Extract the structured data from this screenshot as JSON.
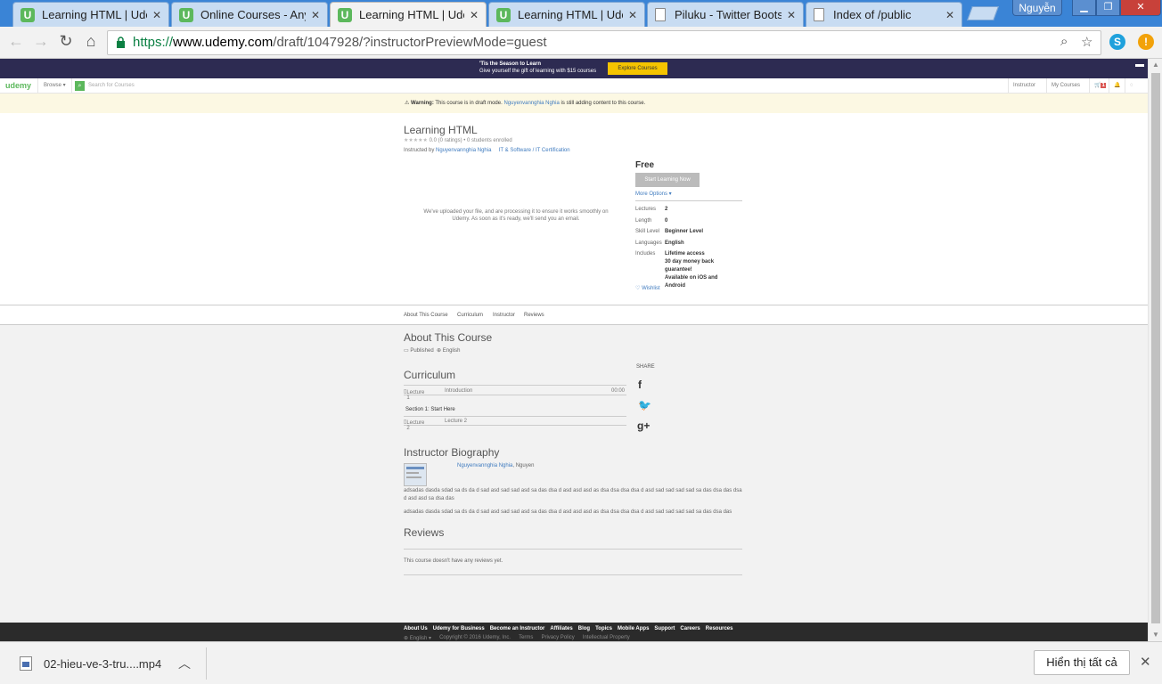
{
  "browser": {
    "tabs": [
      {
        "title": "Learning HTML | Udem",
        "icon": "udemy-icon",
        "active": false
      },
      {
        "title": "Online Courses - Anyt",
        "icon": "udemy-icon",
        "active": false
      },
      {
        "title": "Learning HTML | Udem",
        "icon": "udemy-icon",
        "active": true
      },
      {
        "title": "Learning HTML | Udem",
        "icon": "udemy-icon",
        "active": false
      },
      {
        "title": "Piluku - Twitter Boots",
        "icon": "document-icon",
        "active": false
      },
      {
        "title": "Index of /public",
        "icon": "document-icon",
        "active": false
      }
    ],
    "user": "Nguyễn",
    "url": {
      "scheme": "https://",
      "host": "www.udemy.com",
      "path": "/draft/1047928/?instructorPreviewMode=guest"
    }
  },
  "promo": {
    "line1": "'Tis the Season to Learn",
    "line2": "Give yourself the gift of learning with $15 courses",
    "cta": "Explore Courses"
  },
  "header": {
    "logo": "udemy",
    "browse": "Browse",
    "search_placeholder": "Search for Courses",
    "instructor": "Instructor",
    "my_courses": "My Courses",
    "cart_count": "1"
  },
  "warning": {
    "label": "Warning:",
    "text_before": "This course is in draft mode.",
    "author": "Nguyenvannghia Nghia",
    "text_after": "is still adding content to this course."
  },
  "course": {
    "title": "Learning HTML",
    "rating": "0.0 (0 ratings)",
    "students": "0 students enrolled",
    "instructed_by": "Instructed by",
    "instructor": "Nguyenvannghia Nghia",
    "category": "IT & Software / IT Certification",
    "video_message": "We've uploaded your file, and are processing it to ensure it works smoothly on Udemy. As soon as it's ready, we'll send you an email.",
    "price": "Free",
    "start_button": "Start Learning Now",
    "more_options": "More Options",
    "specs": [
      {
        "key": "Lectures",
        "value": "2"
      },
      {
        "key": "Length",
        "value": "0"
      },
      {
        "key": "Skill Level",
        "value": "Beginner Level"
      },
      {
        "key": "Languages",
        "value": "English"
      },
      {
        "key": "Includes",
        "value": "Lifetime access"
      }
    ],
    "includes_extra": [
      "30 day money back guarantee!",
      "Available on iOS and Android"
    ],
    "wishlist": "Wishlist"
  },
  "subnav": [
    "About This Course",
    "Curriculum",
    "Instructor",
    "Reviews"
  ],
  "about": {
    "title": "About This Course",
    "published": "Published",
    "language": "English"
  },
  "curriculum": {
    "title": "Curriculum",
    "lecture1": {
      "label": "Lecture 1",
      "name": "Introduction",
      "time": "00:00"
    },
    "section": "Section 1: Start Here",
    "lecture2": {
      "label": "Lecture 2",
      "name": "Lecture 2"
    }
  },
  "share": {
    "label": "SHARE",
    "icons": [
      "facebook-icon",
      "twitter-icon",
      "google-plus-icon"
    ]
  },
  "bio": {
    "title": "Instructor Biography",
    "name_link": "Nguyenvannghia Nghia",
    "name_suffix": ", Nguyen",
    "p1": "adsadas dasda  sdad sa ds da d sad asd sad sad asd sa das dsa d asd asd asd as dsa dsa dsa dsa d asd sad sad sad sad sa das dsa das dsa d asd asd sa dsa das",
    "p2": "adsadas dasda  sdad sa ds da d sad asd sad sad asd sa das dsa d asd asd asd as dsa dsa dsa dsa d asd sad sad sad sad sa das dsa das"
  },
  "reviews": {
    "title": "Reviews",
    "empty": "This course doesn't have any reviews yet."
  },
  "footer": {
    "links": [
      "About Us",
      "Udemy for Business",
      "Become an Instructor",
      "Affiliates",
      "Blog",
      "Topics",
      "Mobile Apps",
      "Support",
      "Careers",
      "Resources"
    ],
    "legal": [
      "English",
      "Copyright © 2016 Udemy, Inc.",
      "Terms",
      "Privacy Policy",
      "Intellectual Property"
    ]
  },
  "download": {
    "filename": "02-hieu-ve-3-tru....mp4",
    "show_all": "Hiển thị tất cả"
  }
}
